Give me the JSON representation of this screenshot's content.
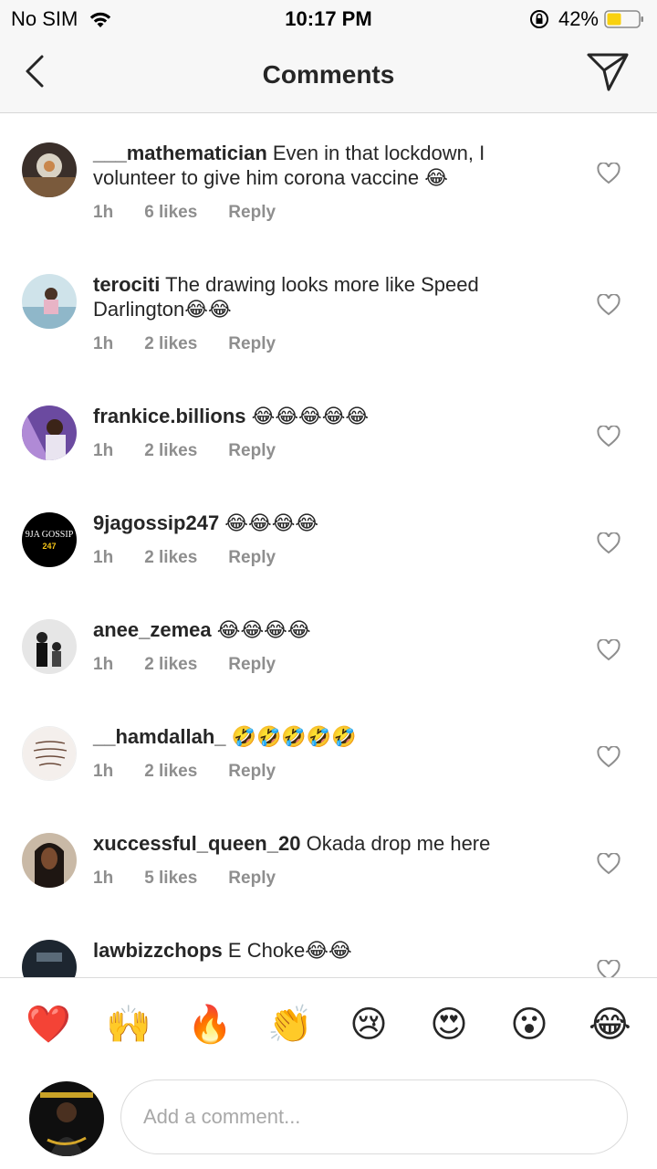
{
  "status_bar": {
    "carrier": "No SIM",
    "time": "10:17 PM",
    "battery": "42%"
  },
  "nav": {
    "title": "Comments"
  },
  "comments": [
    {
      "user": "___mathematician",
      "text": " Even in that lockdown, I volunteer to give him corona vaccine 😂",
      "time": "1h",
      "likes": "6 likes",
      "reply": "Reply"
    },
    {
      "user": "terociti",
      "text": " The drawing looks more like Speed Darlington😂😂",
      "time": "1h",
      "likes": "2 likes",
      "reply": "Reply"
    },
    {
      "user": "frankice.billions",
      "text": " 😂😂😂😂😂",
      "time": "1h",
      "likes": "2 likes",
      "reply": "Reply"
    },
    {
      "user": "9jagossip247",
      "text": " 😂😂😂😂",
      "time": "1h",
      "likes": "2 likes",
      "reply": "Reply",
      "avatar_text": [
        "9JA GOSSIP",
        "247"
      ]
    },
    {
      "user": "anee_zemea",
      "text": " 😂😂😂😂",
      "time": "1h",
      "likes": "2 likes",
      "reply": "Reply"
    },
    {
      "user": "__hamdallah_",
      "text": " 🤣🤣🤣🤣🤣",
      "time": "1h",
      "likes": "2 likes",
      "reply": "Reply"
    },
    {
      "user": "xuccessful_queen_20",
      "text": " Okada drop me here",
      "time": "1h",
      "likes": "5 likes",
      "reply": "Reply"
    },
    {
      "user": "lawbizzchops",
      "text": " E Choke😂😂",
      "time": "",
      "likes": "",
      "reply": ""
    }
  ],
  "emoji_bar": [
    "❤️",
    "🙌",
    "🔥",
    "👏",
    "😢",
    "😍",
    "😮",
    "😂"
  ],
  "input": {
    "placeholder": "Add a comment..."
  },
  "colors": {
    "meta_gray": "#8e8e8e",
    "text": "#262626",
    "battery_fill": "#f9d10f"
  }
}
